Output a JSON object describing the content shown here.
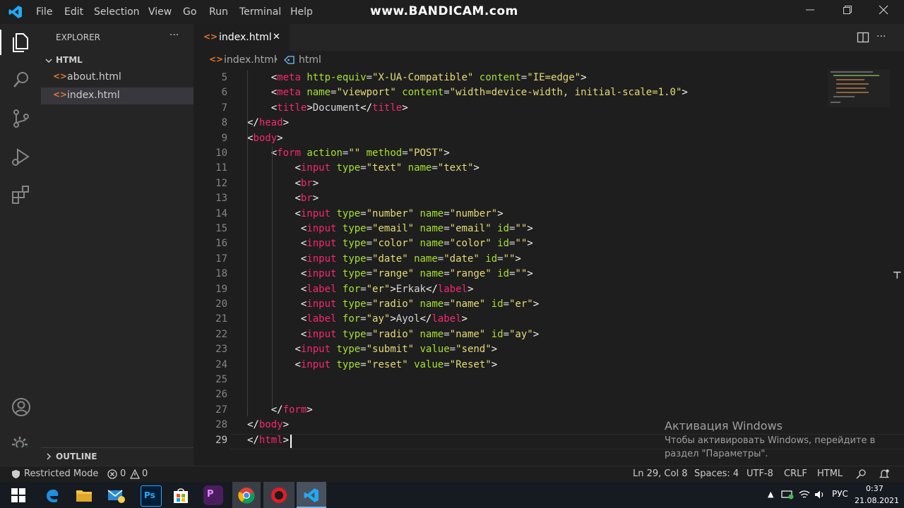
{
  "titlebar": {
    "menu": [
      "File",
      "Edit",
      "Selection",
      "View",
      "Go",
      "Run",
      "Terminal",
      "Help"
    ],
    "watermark": "www.BANDICAM.com"
  },
  "sidebar": {
    "title": "EXPLORER",
    "more": "···",
    "folder": "HTML",
    "files": [
      "about.html",
      "index.html"
    ],
    "outline": "OUTLINE"
  },
  "tab": {
    "label": "index.html",
    "close": "✕"
  },
  "breadcrumb": {
    "file": "index.html",
    "separator": "›",
    "symbol": "html"
  },
  "editor": {
    "lines": [
      {
        "n": "5",
        "html": "    <span class='p'>&lt;</span><span class='t'>meta</span> <span class='a'>http-equiv</span>=<span class='s'>\"X-UA-Compatible\"</span> <span class='a'>content</span>=<span class='s'>\"IE=edge\"</span><span class='p'>&gt;</span>"
      },
      {
        "n": "6",
        "html": "    <span class='p'>&lt;</span><span class='t'>meta</span> <span class='a'>name</span>=<span class='s'>\"viewport\"</span> <span class='a'>content</span>=<span class='s'>\"width=device-width, initial-scale=1.0\"</span><span class='p'>&gt;</span>"
      },
      {
        "n": "7",
        "html": "    <span class='p'>&lt;</span><span class='t'>title</span><span class='p'>&gt;</span>Document<span class='p'>&lt;/</span><span class='t'>title</span><span class='p'>&gt;</span>"
      },
      {
        "n": "8",
        "html": "<span class='p'>&lt;/</span><span class='t'>head</span><span class='p'>&gt;</span>"
      },
      {
        "n": "9",
        "html": "<span class='p'>&lt;</span><span class='t'>body</span><span class='p'>&gt;</span>"
      },
      {
        "n": "10",
        "html": "    <span class='p'>&lt;</span><span class='t'>form</span> <span class='a'>action</span>=<span class='s'>\"\"</span> <span class='a'>method</span>=<span class='s'>\"POST\"</span><span class='p'>&gt;</span>"
      },
      {
        "n": "11",
        "html": "        <span class='p'>&lt;</span><span class='t'>input</span> <span class='a'>type</span>=<span class='s'>\"text\"</span> <span class='a'>name</span>=<span class='s'>\"text\"</span><span class='p'>&gt;</span>"
      },
      {
        "n": "12",
        "html": "        <span class='p'>&lt;</span><span class='t'>br</span><span class='p'>&gt;</span>"
      },
      {
        "n": "13",
        "html": "        <span class='p'>&lt;</span><span class='t'>br</span><span class='p'>&gt;</span>"
      },
      {
        "n": "14",
        "html": "        <span class='p'>&lt;</span><span class='t'>input</span> <span class='a'>type</span>=<span class='s'>\"number\"</span> <span class='a'>name</span>=<span class='s'>\"number\"</span><span class='p'>&gt;</span>"
      },
      {
        "n": "15",
        "html": "         <span class='p'>&lt;</span><span class='t'>input</span> <span class='a'>type</span>=<span class='s'>\"email\"</span> <span class='a'>name</span>=<span class='s'>\"email\"</span> <span class='a'>id</span>=<span class='s'>\"\"</span><span class='p'>&gt;</span>"
      },
      {
        "n": "16",
        "html": "         <span class='p'>&lt;</span><span class='t'>input</span> <span class='a'>type</span>=<span class='s'>\"color\"</span> <span class='a'>name</span>=<span class='s'>\"color\"</span> <span class='a'>id</span>=<span class='s'>\"\"</span><span class='p'>&gt;</span>"
      },
      {
        "n": "17",
        "html": "         <span class='p'>&lt;</span><span class='t'>input</span> <span class='a'>type</span>=<span class='s'>\"date\"</span> <span class='a'>name</span>=<span class='s'>\"date\"</span> <span class='a'>id</span>=<span class='s'>\"\"</span><span class='p'>&gt;</span>"
      },
      {
        "n": "18",
        "html": "         <span class='p'>&lt;</span><span class='t'>input</span> <span class='a'>type</span>=<span class='s'>\"range\"</span> <span class='a'>name</span>=<span class='s'>\"range\"</span> <span class='a'>id</span>=<span class='s'>\"\"</span><span class='p'>&gt;</span>"
      },
      {
        "n": "19",
        "html": "         <span class='p'>&lt;</span><span class='t'>label</span> <span class='a'>for</span>=<span class='s'>\"er\"</span><span class='p'>&gt;</span>Erkak<span class='p'>&lt;/</span><span class='t'>label</span><span class='p'>&gt;</span>"
      },
      {
        "n": "20",
        "html": "         <span class='p'>&lt;</span><span class='t'>input</span> <span class='a'>type</span>=<span class='s'>\"radio\"</span> <span class='a'>name</span>=<span class='s'>\"name\"</span> <span class='a'>id</span>=<span class='s'>\"er\"</span><span class='p'>&gt;</span>"
      },
      {
        "n": "21",
        "html": "         <span class='p'>&lt;</span><span class='t'>label</span> <span class='a'>for</span>=<span class='s'>\"ay\"</span><span class='p'>&gt;</span>Ayol<span class='p'>&lt;/</span><span class='t'>label</span><span class='p'>&gt;</span>"
      },
      {
        "n": "22",
        "html": "         <span class='p'>&lt;</span><span class='t'>input</span> <span class='a'>type</span>=<span class='s'>\"radio\"</span> <span class='a'>name</span>=<span class='s'>\"name\"</span> <span class='a'>id</span>=<span class='s'>\"ay\"</span><span class='p'>&gt;</span>"
      },
      {
        "n": "23",
        "html": "        <span class='p'>&lt;</span><span class='t'>input</span> <span class='a'>type</span>=<span class='s'>\"submit\"</span> <span class='a'>value</span>=<span class='s'>\"send\"</span><span class='p'>&gt;</span>"
      },
      {
        "n": "24",
        "html": "        <span class='p'>&lt;</span><span class='t'>input</span> <span class='a'>type</span>=<span class='s'>\"reset\"</span> <span class='a'>value</span>=<span class='s'>\"Reset\"</span><span class='p'>&gt;</span>"
      },
      {
        "n": "25",
        "html": ""
      },
      {
        "n": "26",
        "html": ""
      },
      {
        "n": "27",
        "html": "    <span class='p'>&lt;/</span><span class='t'>form</span><span class='p'>&gt;</span>"
      },
      {
        "n": "28",
        "html": "<span class='p'>&lt;/</span><span class='t'>body</span><span class='p'>&gt;</span>"
      },
      {
        "n": "29",
        "html": "<span class='p'>&lt;/</span><span class='t'>html</span><span class='p'>&gt;</span>"
      }
    ]
  },
  "activation": {
    "title": "Активация Windows",
    "line1": "Чтобы активировать Windows, перейдите в",
    "line2": "раздел \"Параметры\"."
  },
  "statusbar": {
    "restricted": "Restricted Mode",
    "errors": "0",
    "warnings": "0",
    "position": "Ln 29, Col 8",
    "spaces": "Spaces: 4",
    "encoding": "UTF-8",
    "eol": "CRLF",
    "language": "HTML"
  },
  "taskbar": {
    "lang": "РУС",
    "time": "0:37",
    "date": "21.08.2021"
  },
  "colors": {
    "accent": "#007acc",
    "tag": "#f92672",
    "attr": "#a6e22e",
    "string": "#e6db74"
  }
}
